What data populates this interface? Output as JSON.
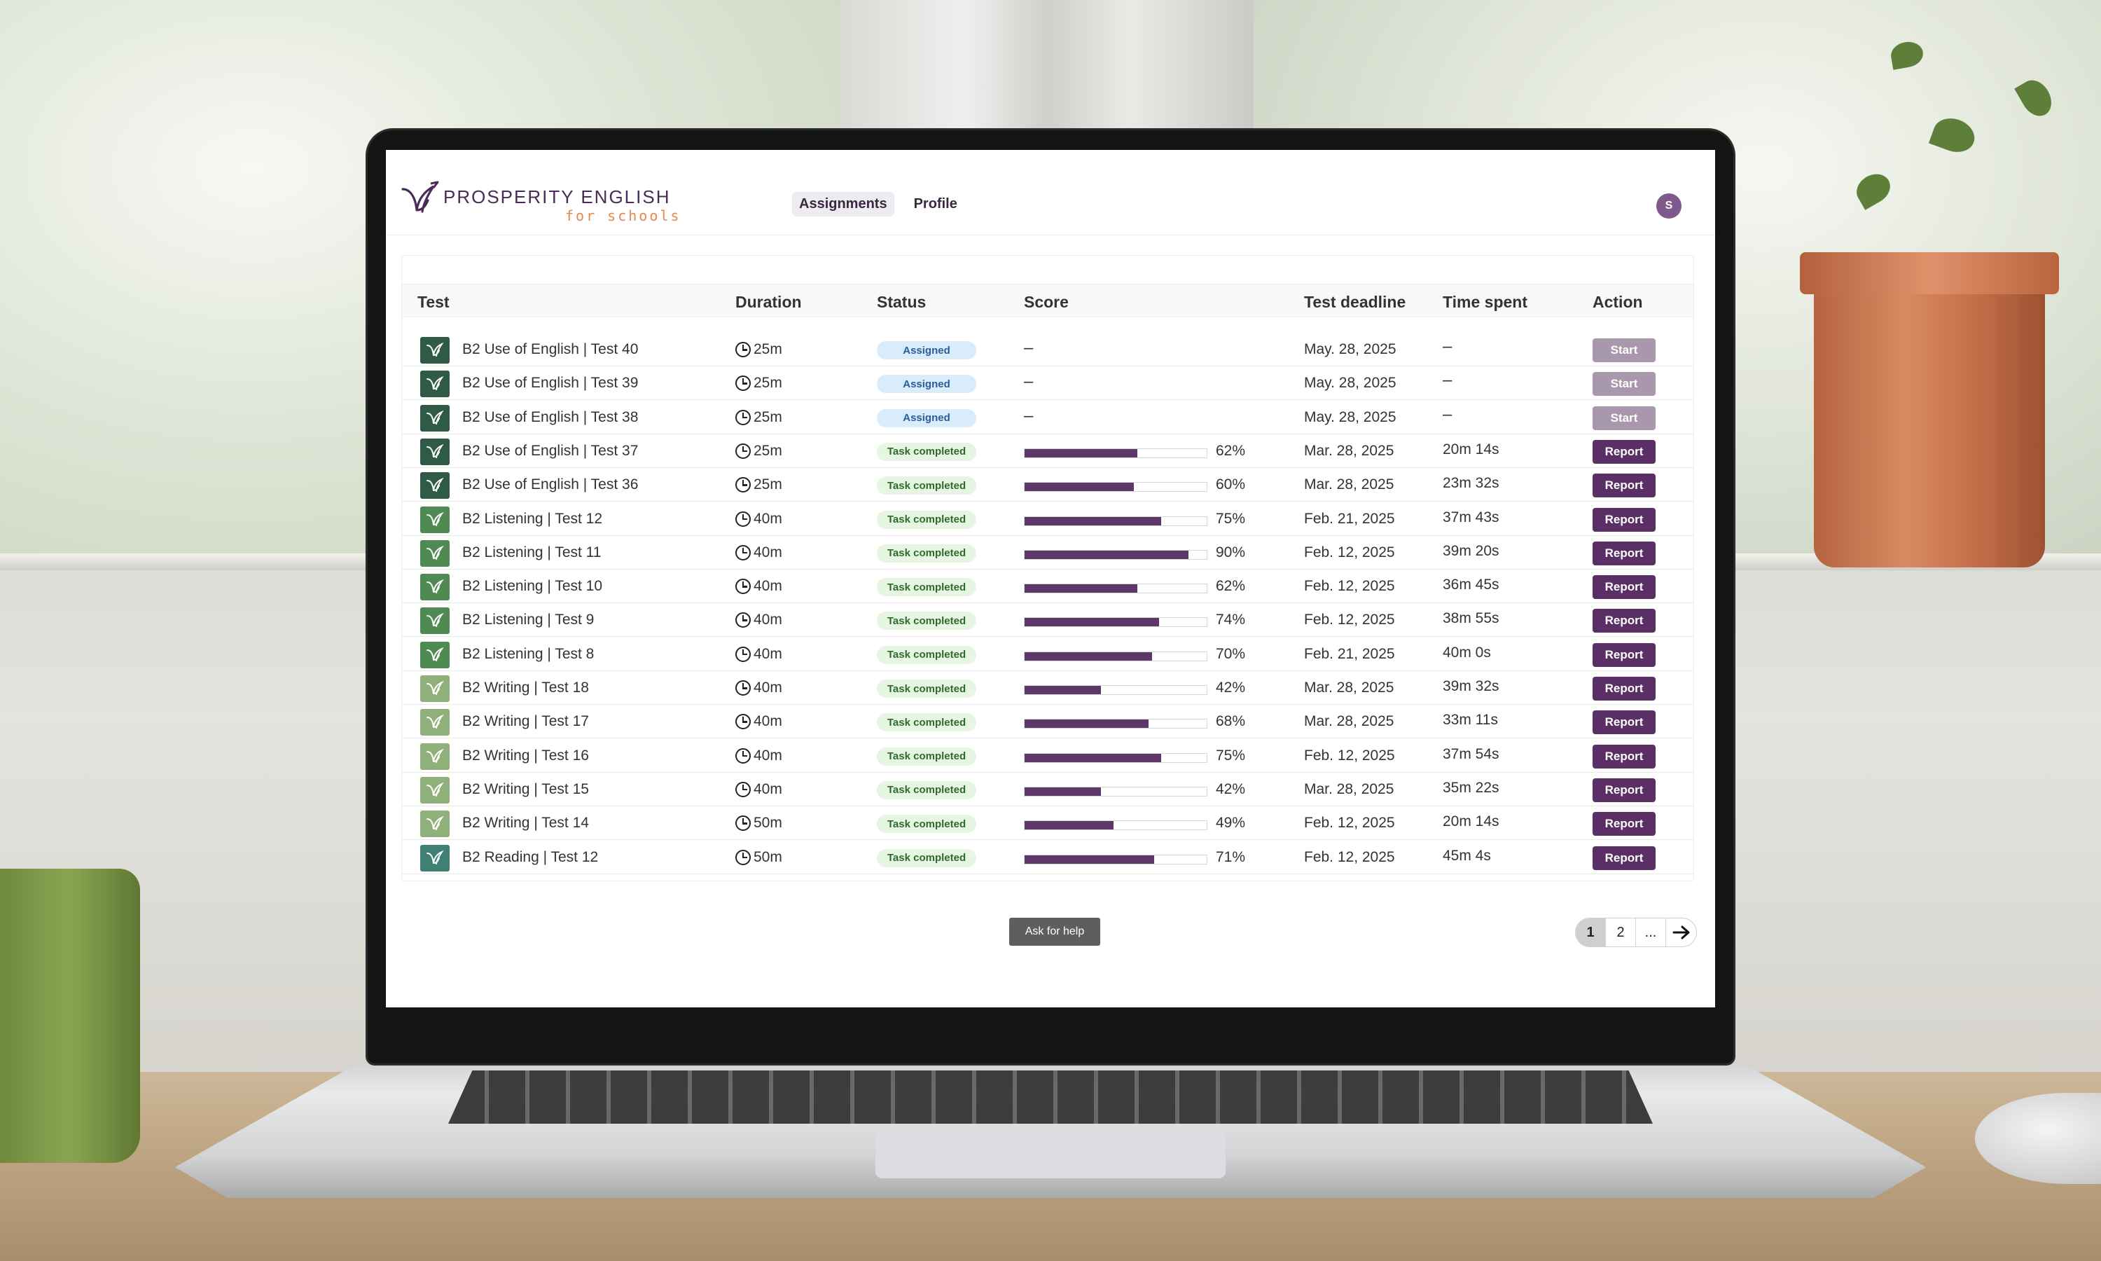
{
  "app": {
    "brand_name": "PROSPERITY ENGLISH",
    "brand_sub": "for schools",
    "nav": [
      {
        "label": "Assignments",
        "active": true
      },
      {
        "label": "Profile",
        "active": false
      }
    ],
    "avatar_initial": "S"
  },
  "table": {
    "columns": [
      "Test",
      "Duration",
      "Status",
      "Score",
      "Test deadline",
      "Time spent",
      "Action"
    ],
    "rows": [
      {
        "name": "B2 Use of English | Test 40",
        "duration": "25m",
        "status": "Assigned",
        "score": null,
        "deadline": "May. 28, 2025",
        "time_spent": "–",
        "action": "Start",
        "category": "use-of-english"
      },
      {
        "name": "B2 Use of English | Test 39",
        "duration": "25m",
        "status": "Assigned",
        "score": null,
        "deadline": "May. 28, 2025",
        "time_spent": "–",
        "action": "Start",
        "category": "use-of-english"
      },
      {
        "name": "B2 Use of English | Test 38",
        "duration": "25m",
        "status": "Assigned",
        "score": null,
        "deadline": "May. 28, 2025",
        "time_spent": "–",
        "action": "Start",
        "category": "use-of-english"
      },
      {
        "name": "B2 Use of English | Test 37",
        "duration": "25m",
        "status": "Task completed",
        "score": "62%",
        "deadline": "Mar. 28, 2025",
        "time_spent": "20m 14s",
        "action": "Report",
        "category": "use-of-english"
      },
      {
        "name": "B2 Use of English | Test 36",
        "duration": "25m",
        "status": "Task completed",
        "score": "60%",
        "deadline": "Mar. 28, 2025",
        "time_spent": "23m 32s",
        "action": "Report",
        "category": "use-of-english"
      },
      {
        "name": "B2 Listening | Test 12",
        "duration": "40m",
        "status": "Task completed",
        "score": "75%",
        "deadline": "Feb. 21, 2025",
        "time_spent": "37m 43s",
        "action": "Report",
        "category": "listening"
      },
      {
        "name": "B2 Listening | Test 11",
        "duration": "40m",
        "status": "Task completed",
        "score": "90%",
        "deadline": "Feb. 12, 2025",
        "time_spent": "39m 20s",
        "action": "Report",
        "category": "listening"
      },
      {
        "name": "B2 Listening | Test 10",
        "duration": "40m",
        "status": "Task completed",
        "score": "62%",
        "deadline": "Feb. 12, 2025",
        "time_spent": "36m 45s",
        "action": "Report",
        "category": "listening"
      },
      {
        "name": "B2 Listening | Test 9",
        "duration": "40m",
        "status": "Task completed",
        "score": "74%",
        "deadline": "Feb. 12, 2025",
        "time_spent": "38m 55s",
        "action": "Report",
        "category": "listening"
      },
      {
        "name": "B2 Listening | Test 8",
        "duration": "40m",
        "status": "Task completed",
        "score": "70%",
        "deadline": "Feb. 21, 2025",
        "time_spent": "40m 0s",
        "action": "Report",
        "category": "listening"
      },
      {
        "name": "B2 Writing | Test 18",
        "duration": "40m",
        "status": "Task completed",
        "score": "42%",
        "deadline": "Mar. 28, 2025",
        "time_spent": "39m 32s",
        "action": "Report",
        "category": "writing"
      },
      {
        "name": "B2 Writing | Test 17",
        "duration": "40m",
        "status": "Task completed",
        "score": "68%",
        "deadline": "Mar. 28, 2025",
        "time_spent": "33m 11s",
        "action": "Report",
        "category": "writing"
      },
      {
        "name": "B2 Writing | Test 16",
        "duration": "40m",
        "status": "Task completed",
        "score": "75%",
        "deadline": "Feb. 12, 2025",
        "time_spent": "37m 54s",
        "action": "Report",
        "category": "writing"
      },
      {
        "name": "B2 Writing | Test 15",
        "duration": "40m",
        "status": "Task completed",
        "score": "42%",
        "deadline": "Mar. 28, 2025",
        "time_spent": "35m 22s",
        "action": "Report",
        "category": "writing"
      },
      {
        "name": "B2 Writing | Test 14",
        "duration": "50m",
        "status": "Task completed",
        "score": "49%",
        "deadline": "Feb. 12, 2025",
        "time_spent": "20m 14s",
        "action": "Report",
        "category": "writing"
      },
      {
        "name": "B2 Reading | Test 12",
        "duration": "50m",
        "status": "Task completed",
        "score": "71%",
        "deadline": "Feb. 12, 2025",
        "time_spent": "45m 4s",
        "action": "Report",
        "category": "reading"
      }
    ]
  },
  "footer": {
    "help_label": "Ask for help",
    "pages": [
      "1",
      "2",
      "..."
    ],
    "current_page": "1"
  },
  "colors": {
    "brand_purple": "#5a2f66",
    "start_button": "#a997ad",
    "score_bar": "#5c3768",
    "assigned_badge": "#d9ecfb",
    "completed_badge": "#e6f6e3",
    "icon_use_of_english": "#2f5a45",
    "icon_listening": "#4e8a52",
    "icon_writing": "#8fb07a",
    "icon_reading": "#3f7f74"
  }
}
